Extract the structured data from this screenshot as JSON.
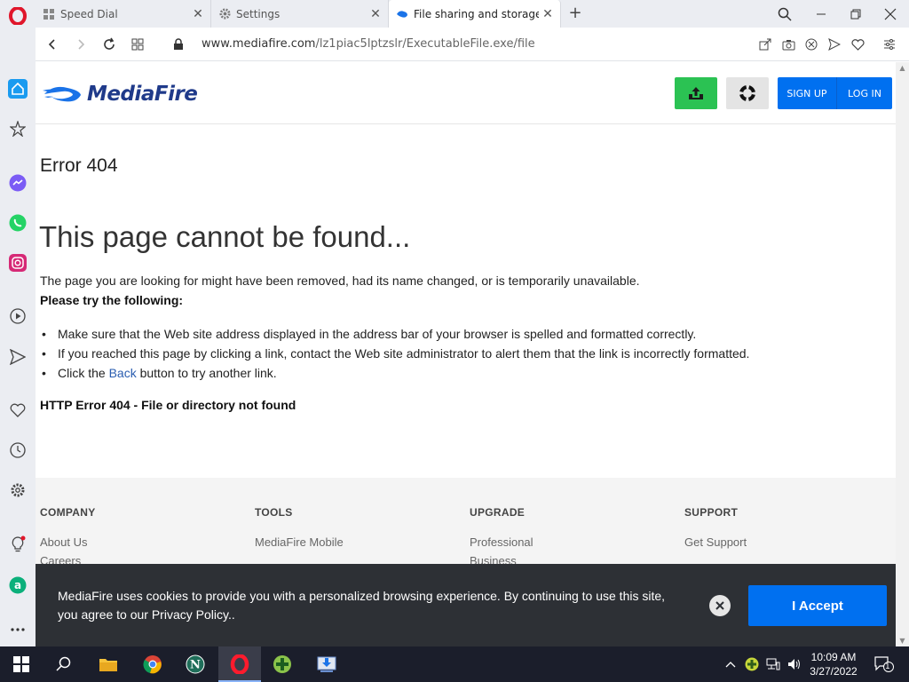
{
  "browser": {
    "tabs": [
      {
        "title": "Speed Dial"
      },
      {
        "title": "Settings"
      },
      {
        "title": "File sharing and storage ma"
      }
    ],
    "url_host": "www.mediafire.com",
    "url_path": "/lz1piac5lptzslr/ExecutableFile.exe/file"
  },
  "site": {
    "logo_text": "MediaFire",
    "signup_label": "SIGN UP",
    "login_label": "LOG IN"
  },
  "content": {
    "error_title": "Error 404",
    "heading": "This page cannot be found...",
    "description": "The page you are looking for might have been removed, had its name changed, or is temporarily unavailable.",
    "try_label": "Please try the following:",
    "suggestions": [
      "Make sure that the Web site address displayed in the address bar of your browser is spelled and formatted correctly.",
      "If you reached this page by clicking a link, contact the Web site administrator to alert them that the link is incorrectly formatted."
    ],
    "back_prefix": "Click the ",
    "back_link": "Back",
    "back_suffix": " button to try another link.",
    "http_error": "HTTP Error 404 - File or directory not found"
  },
  "footer": {
    "columns": [
      {
        "heading": "COMPANY",
        "links": [
          "About Us",
          "Careers"
        ]
      },
      {
        "heading": "TOOLS",
        "links": [
          "MediaFire Mobile"
        ]
      },
      {
        "heading": "UPGRADE",
        "links": [
          "Professional",
          "Business"
        ]
      },
      {
        "heading": "SUPPORT",
        "links": [
          "Get Support"
        ]
      }
    ]
  },
  "cookie": {
    "text": "MediaFire uses cookies to provide you with a personalized browsing experience. By continuing to use this site, you agree to our Privacy Policy..",
    "accept_label": "I Accept"
  },
  "taskbar": {
    "time": "10:09 AM",
    "date": "3/27/2022",
    "notification_count": "1"
  },
  "colors": {
    "mediafire_blue": "#0070f0",
    "upload_green": "#2bc253",
    "cookie_banner": "#2d3035"
  }
}
